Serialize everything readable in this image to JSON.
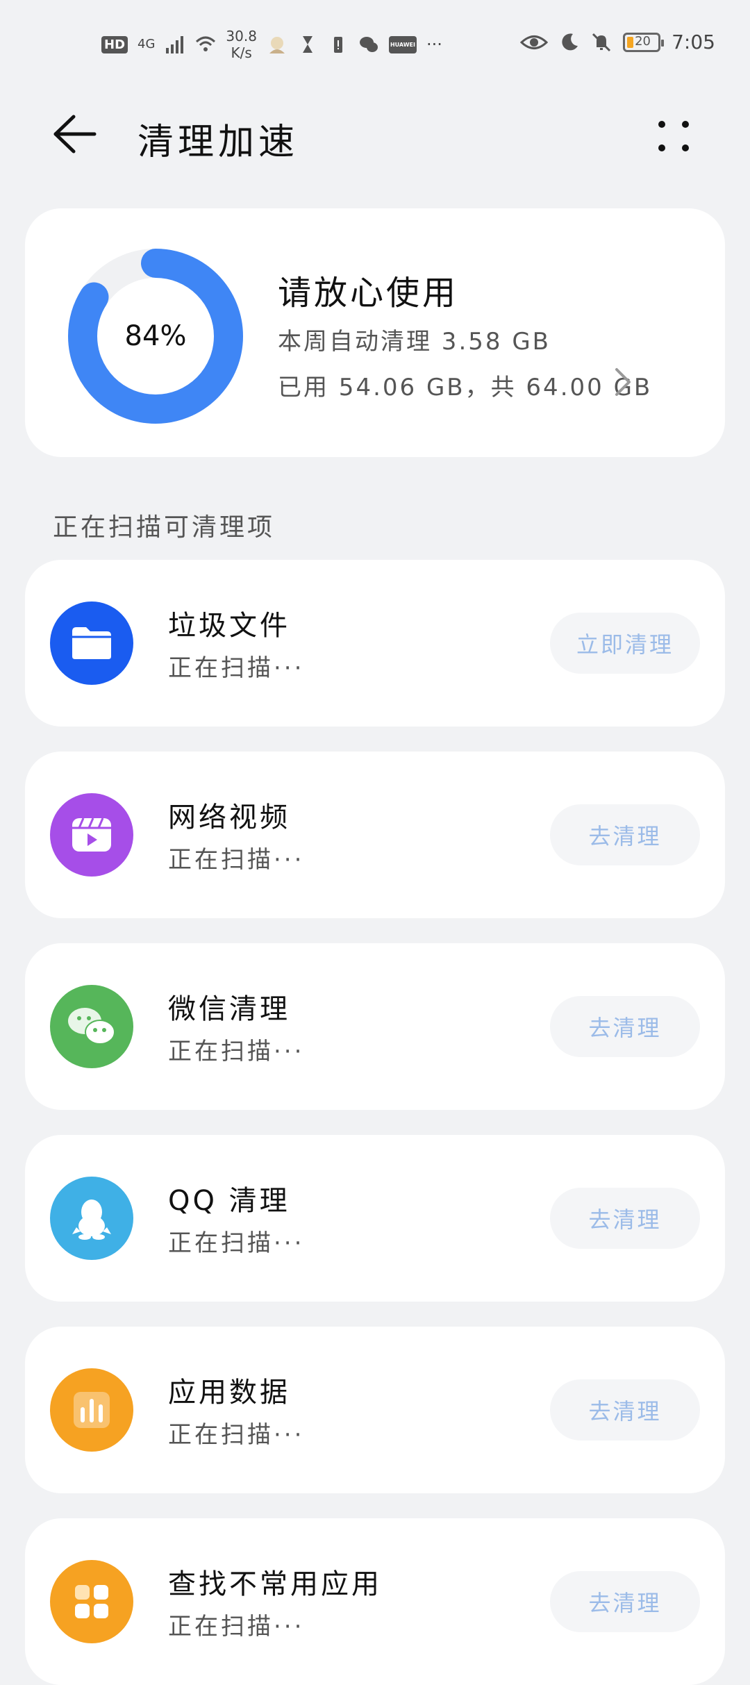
{
  "status_bar": {
    "hd": "HD",
    "network": "4G",
    "speed_value": "30.8",
    "speed_unit": "K/s",
    "huawei_badge": "HUAWEI",
    "more": "···",
    "battery": "20",
    "time": "7:05"
  },
  "header": {
    "title": "清理加速"
  },
  "storage": {
    "percent_label": "84%",
    "used_fraction": 0.84,
    "title": "请放心使用",
    "auto_clean": "本周自动清理 3.58 GB",
    "usage": "已用 54.06 GB，共 64.00 GB"
  },
  "section_title": "正在扫描可清理项",
  "items": [
    {
      "title": "垃圾文件",
      "status": "正在扫描···",
      "button": "立即清理",
      "icon": "folder-icon",
      "color": "#1a5cf0"
    },
    {
      "title": "网络视频",
      "status": "正在扫描···",
      "button": "去清理",
      "icon": "video-icon",
      "color": "#a64ee8"
    },
    {
      "title": "微信清理",
      "status": "正在扫描···",
      "button": "去清理",
      "icon": "wechat-icon",
      "color": "#56b65a"
    },
    {
      "title": "QQ 清理",
      "status": "正在扫描···",
      "button": "去清理",
      "icon": "qq-icon",
      "color": "#3fb0e6"
    },
    {
      "title": "应用数据",
      "status": "正在扫描···",
      "button": "去清理",
      "icon": "bar-chart-icon",
      "color": "#f6a222"
    },
    {
      "title": "查找不常用应用",
      "status": "正在扫描···",
      "button": "去清理",
      "icon": "apps-grid-icon",
      "color": "#f6a222"
    }
  ]
}
